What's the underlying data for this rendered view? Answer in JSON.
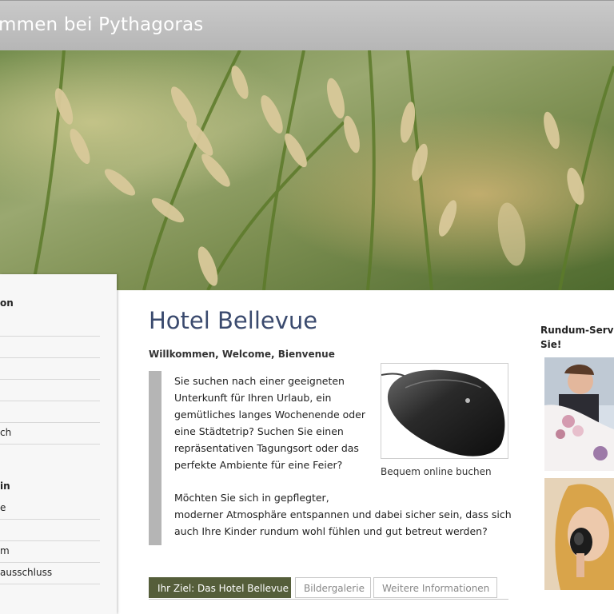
{
  "header": {
    "title": "mmen bei Pythagoras"
  },
  "sidebar": {
    "groups": [
      {
        "heading": "on",
        "items": [
          "",
          "",
          "",
          "",
          "",
          "ch"
        ]
      },
      {
        "heading": "in",
        "items": [
          "e",
          "",
          "m",
          "ausschluss"
        ]
      }
    ]
  },
  "main": {
    "title": "Hotel Bellevue",
    "welcome": "Willkommen, Welcome, Bienvenue",
    "intro_lines": [
      "Sie suchen nach einer geeigneten",
      "Unterkunft für Ihren Urlaub, ein",
      "gemütliches langes Wochenende oder",
      "eine Städtetrip? Suchen Sie einen",
      "repräsentativen Tagungsort oder das",
      "perfekte Ambiente für eine Feier?"
    ],
    "second_lines": [
      "Möchten Sie sich in gepflegter,",
      "moderner Atmosphäre entspannen und dabei sicher sein, dass sich",
      "auch Ihre Kinder rundum wohl fühlen und gut betreut werden?"
    ],
    "image_caption": "Bequem online buchen"
  },
  "tabs": [
    {
      "label": "Ihr Ziel: Das Hotel Bellevue",
      "active": true
    },
    {
      "label": "Bildergalerie",
      "active": false
    },
    {
      "label": "Weitere Informationen",
      "active": false
    }
  ],
  "right": {
    "heading_lines": [
      "Rundum-Servic",
      "Sie!"
    ]
  },
  "colors": {
    "title": "#3a4a6e",
    "active_tab": "#555e3a",
    "banner": "#bdbdbd"
  }
}
